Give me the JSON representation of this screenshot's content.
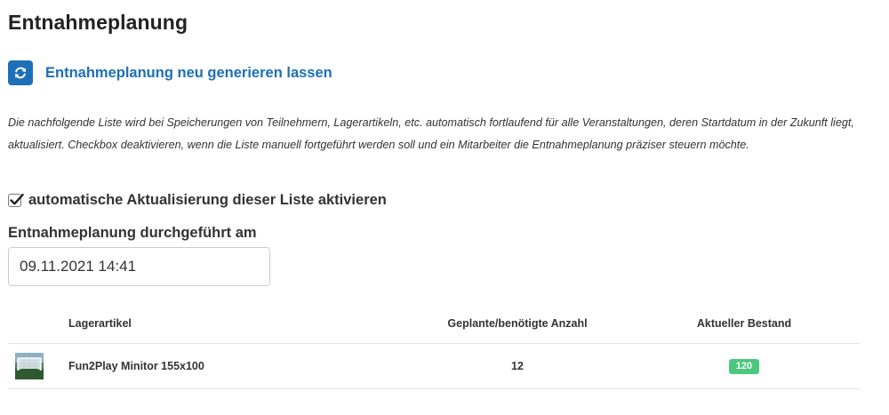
{
  "page": {
    "title": "Entnahmeplanung"
  },
  "regenerate": {
    "icon": "refresh-icon",
    "label": "Entnahmeplanung neu generieren lassen",
    "accent_color": "#1d6fb8"
  },
  "description": "Die nachfolgende Liste wird bei Speicherungen von Teilnehmern, Lagerartikeln, etc. automatisch fortlaufend für alle Veranstaltungen, deren Startdatum in der Zukunft liegt, aktualisiert. Checkbox deaktivieren, wenn die Liste manuell fortgeführt werden soll und ein Mitarbeiter die Entnahmeplanung präziser steuern möchte.",
  "auto_update": {
    "checked": true,
    "label": "automatische Aktualisierung dieser Liste aktivieren"
  },
  "performed_at": {
    "label": "Entnahmeplanung durchgeführt am",
    "value": "09.11.2021 14:41"
  },
  "table": {
    "headers": {
      "article": "Lagerartikel",
      "planned": "Geplante/benötigte Anzahl",
      "stock": "Aktueller Bestand"
    },
    "rows": [
      {
        "image_icon": "goal-thumbnail-icon",
        "article": "Fun2Play Minitor 155x100",
        "planned": "12",
        "stock": "120",
        "stock_badge_color": "#4cc77f"
      }
    ]
  }
}
